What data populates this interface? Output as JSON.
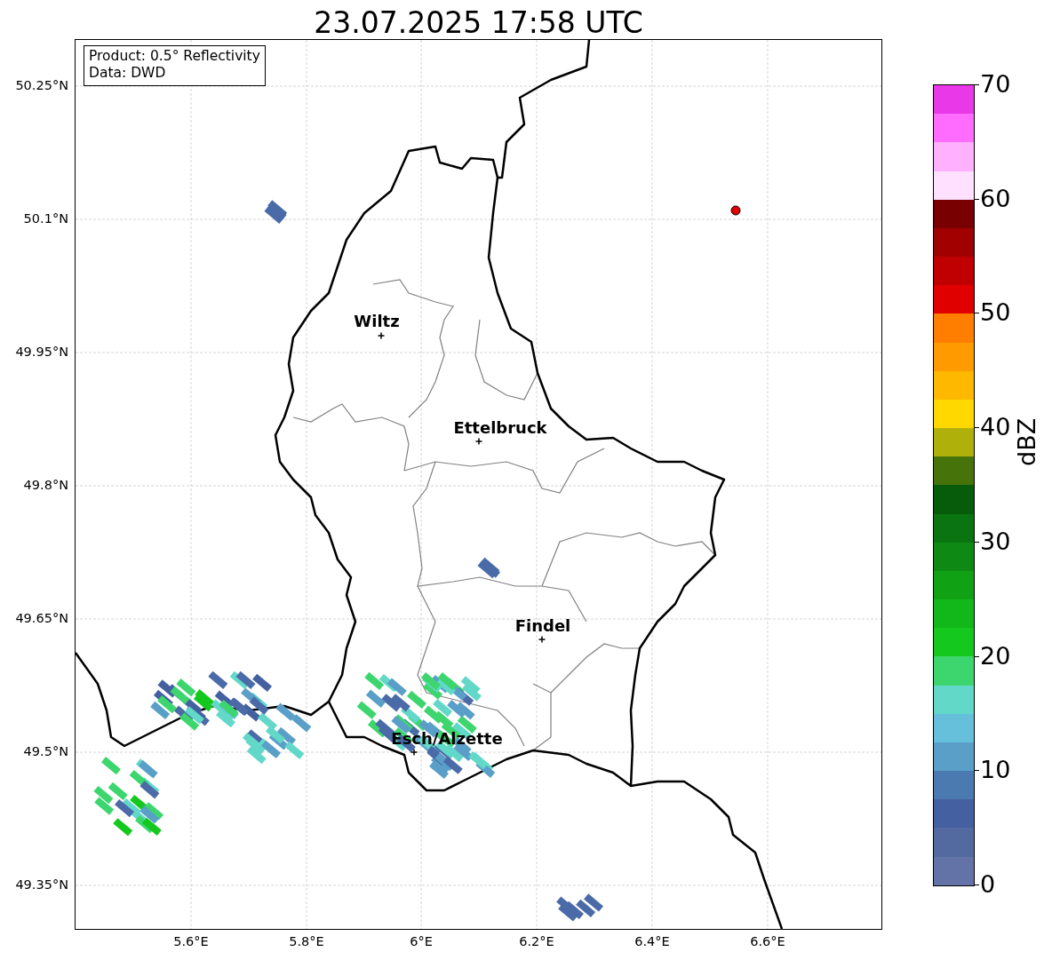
{
  "title": "23.07.2025 17:58 UTC",
  "info_box": [
    "Product: 0.5° Reflectivity",
    "Data: DWD"
  ],
  "y_ticks": [
    "50.25°N",
    "50.1°N",
    "49.95°N",
    "49.8°N",
    "49.65°N",
    "49.5°N",
    "49.35°N"
  ],
  "x_ticks": [
    "5.6°E",
    "5.8°E",
    "6°E",
    "6.2°E",
    "6.4°E",
    "6.6°E"
  ],
  "cities": [
    {
      "name": "Wiltz"
    },
    {
      "name": "Ettelbruck"
    },
    {
      "name": "Findel"
    },
    {
      "name": "Esch/Alzette"
    }
  ],
  "colorbar": {
    "label": "dBZ",
    "ticks": [
      "70",
      "60",
      "50",
      "40",
      "30",
      "20",
      "10",
      "0"
    ],
    "bins": [
      {
        "color": "#6373a8"
      },
      {
        "color": "#536aa0"
      },
      {
        "color": "#4560a0"
      },
      {
        "color": "#4b7ab0"
      },
      {
        "color": "#5a9fc8"
      },
      {
        "color": "#66c0dc"
      },
      {
        "color": "#62d8c8"
      },
      {
        "color": "#3dd66e"
      },
      {
        "color": "#14c81e"
      },
      {
        "color": "#12b81a"
      },
      {
        "color": "#10a214"
      },
      {
        "color": "#0e8a14"
      },
      {
        "color": "#0a7410"
      },
      {
        "color": "#075c0c"
      },
      {
        "color": "#46740a"
      },
      {
        "color": "#b0b00a"
      },
      {
        "color": "#ffd800"
      },
      {
        "color": "#ffb800"
      },
      {
        "color": "#ff9a00"
      },
      {
        "color": "#ff7e00"
      },
      {
        "color": "#e00000"
      },
      {
        "color": "#c00000"
      },
      {
        "color": "#a00000"
      },
      {
        "color": "#780000"
      },
      {
        "color": "#ffe0ff"
      },
      {
        "color": "#ffb0ff"
      },
      {
        "color": "#ff6cff"
      },
      {
        "color": "#e838e8"
      }
    ]
  }
}
